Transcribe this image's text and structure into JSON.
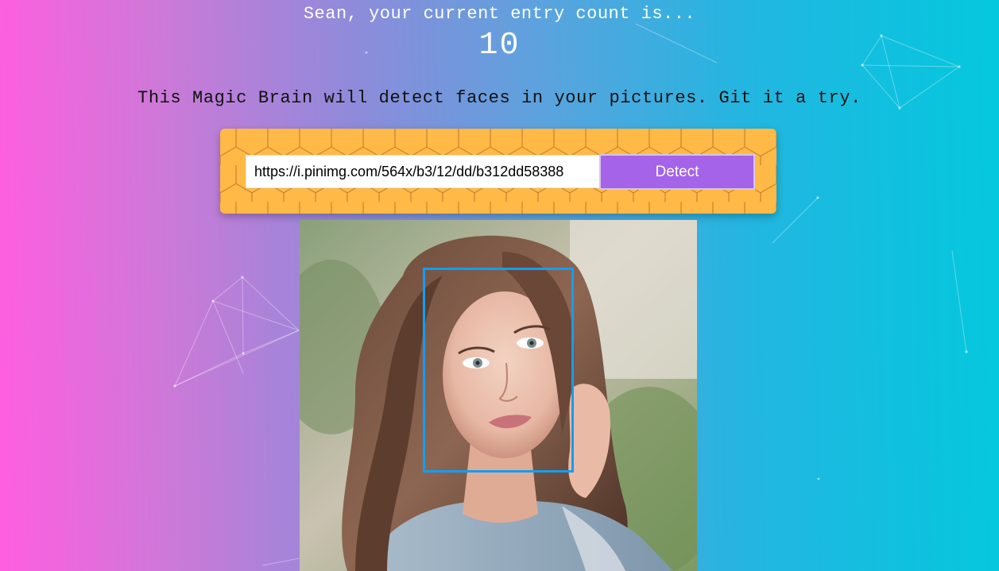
{
  "user": {
    "greeting": "Sean, your current entry count is...",
    "entry_count": "10"
  },
  "tagline": "This Magic Brain will detect faces in your pictures. Git it a try.",
  "form": {
    "url_value": "https://i.pinimg.com/564x/b3/12/dd/b312dd58388",
    "detect_label": "Detect"
  },
  "detected_faces": 1,
  "colors": {
    "gradient_left": "#ff5edf",
    "gradient_right": "#04c8de",
    "panel": "#ffb946",
    "button": "#a463e8",
    "face_box": "#149df2"
  }
}
